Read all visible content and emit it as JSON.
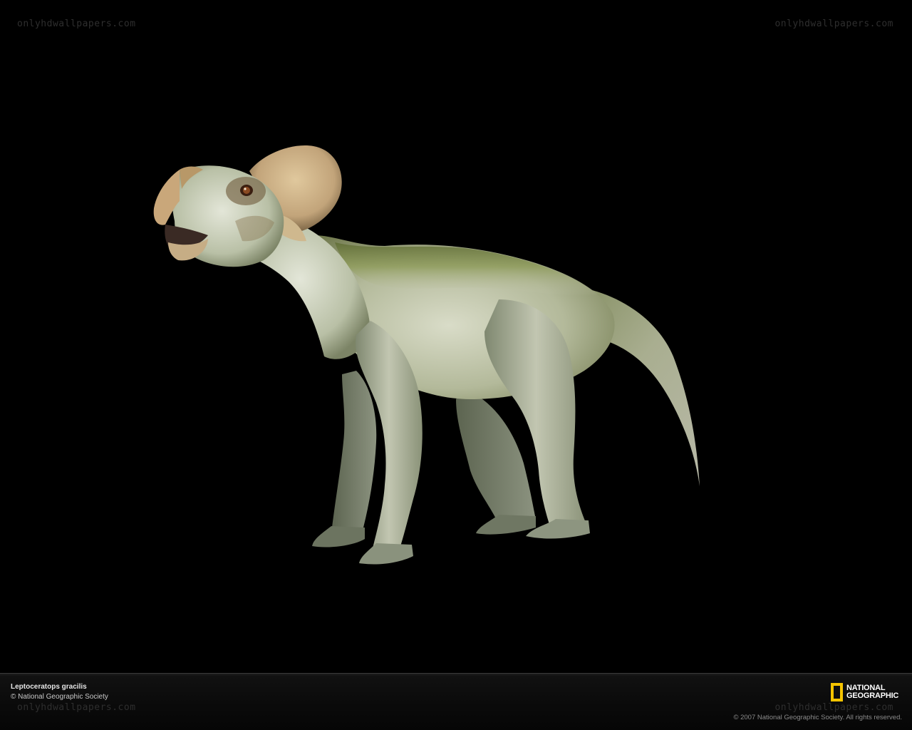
{
  "watermark": {
    "text": "onlyhdwallpapers.com"
  },
  "caption": {
    "species": "Leptoceratops gracilis",
    "credit": "© National Geographic Society"
  },
  "logo": {
    "line1": "NATIONAL",
    "line2": "GEOGRAPHIC",
    "frame_color": "#f5c400"
  },
  "copyright": "© 2007 National Geographic Society. All rights reserved.",
  "colors": {
    "background": "#000000",
    "skin_light": "#cfd3bd",
    "skin_green": "#7f8c55",
    "frill": "#c9ad82"
  }
}
